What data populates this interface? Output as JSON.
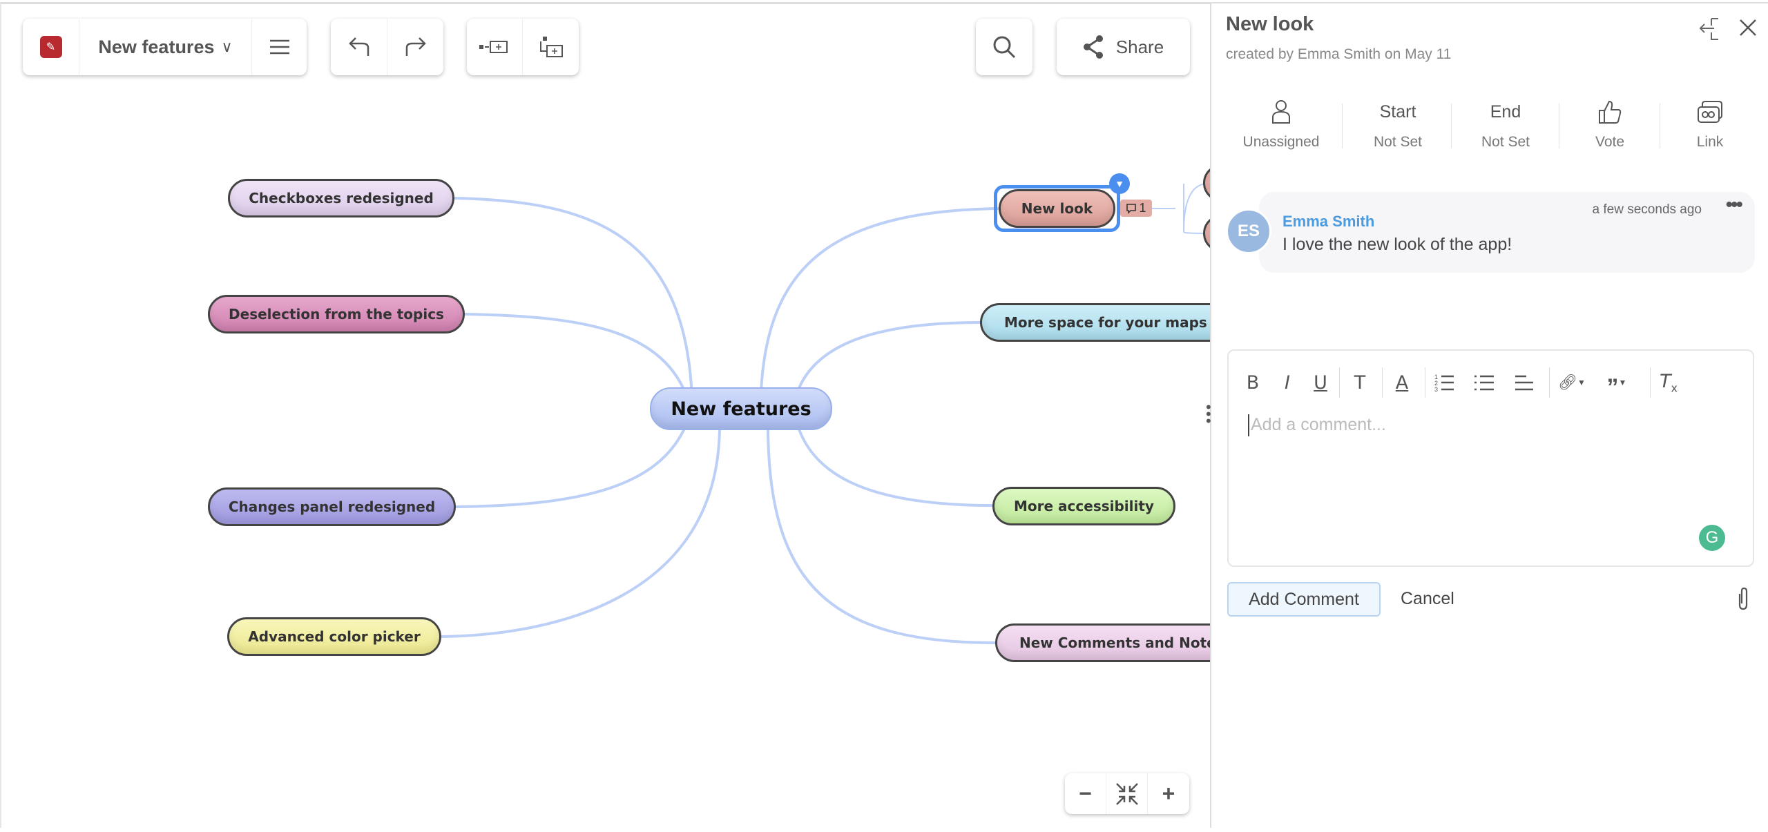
{
  "toolbar": {
    "map_title": "New features",
    "share_label": "Share",
    "icons": [
      "app-logo",
      "chevron-down-icon",
      "menu-icon",
      "undo-icon",
      "redo-icon",
      "add-sibling-topic-icon",
      "add-child-topic-icon",
      "search-icon",
      "share-icon"
    ]
  },
  "map": {
    "central": "New features",
    "left_topics": [
      "Checkboxes redesigned",
      "Deselection from the topics",
      "Changes panel redesigned",
      "Advanced color picker"
    ],
    "right_topics": [
      "New look",
      "More space for your maps",
      "More accessibility",
      "New Comments and Notes"
    ],
    "selected_topic": "New look",
    "comment_count": "1",
    "colors": {
      "checkboxes": "#e4d3ef",
      "deselection": "#d98bb8",
      "changes": "#aaa5e6",
      "color_picker": "#f2efa0",
      "new_look": "#e3aca4",
      "more_space": "#b7e3f1",
      "accessibility": "#cbf0aa",
      "comments": "#ecd0ea",
      "central": "#b9c9f5",
      "link": "#bccff6",
      "selection": "#4a8ff0"
    }
  },
  "zoom_controls": {
    "minus": "−",
    "plus": "+"
  },
  "panel": {
    "title": "New look",
    "subtitle": "created by Emma Smith on May 11",
    "actions": [
      {
        "label": "Unassigned",
        "icon": "user-icon"
      },
      {
        "top": "Start",
        "label": "Not Set"
      },
      {
        "top": "End",
        "label": "Not Set"
      },
      {
        "label": "Vote",
        "icon": "thumbs-up-icon"
      },
      {
        "label": "Link",
        "icon": "link-icon"
      }
    ],
    "comment": {
      "initials": "ES",
      "author": "Emma Smith",
      "time": "a few seconds ago",
      "text": "I love the new look of the app!",
      "avatar_color": "#9ab9e0",
      "author_color": "#4a9be0"
    },
    "editor": {
      "placeholder": "Add a comment...",
      "tools": [
        "B",
        "I",
        "U",
        "T",
        "A"
      ]
    },
    "add_comment_label": "Add Comment",
    "cancel_label": "Cancel"
  }
}
